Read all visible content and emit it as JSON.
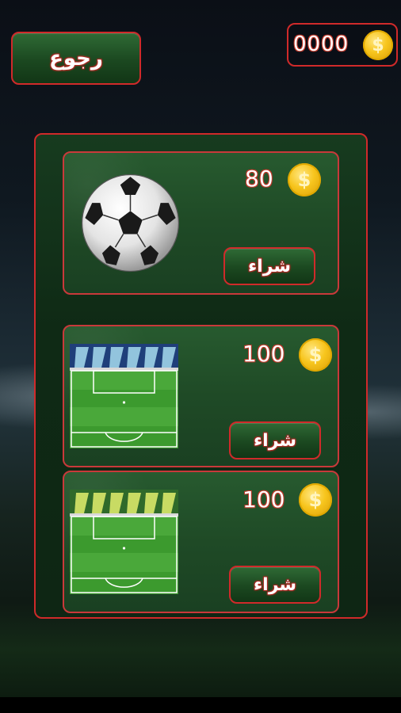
{
  "header": {
    "back_label": "رجوع",
    "coin_balance": "0000",
    "coin_symbol": "$"
  },
  "store": {
    "items": [
      {
        "name": "soccer-ball",
        "price": "80",
        "buy_label": "شراء",
        "coin_symbol": "$"
      },
      {
        "name": "stadium-field-blue",
        "price": "100",
        "buy_label": "شراء",
        "coin_symbol": "$"
      },
      {
        "name": "stadium-field-yellow",
        "price": "100",
        "buy_label": "شراء",
        "coin_symbol": "$"
      }
    ]
  },
  "colors": {
    "accent_border": "#d02a2a",
    "button_green": "#1b4820",
    "coin_gold": "#f7c51d"
  }
}
